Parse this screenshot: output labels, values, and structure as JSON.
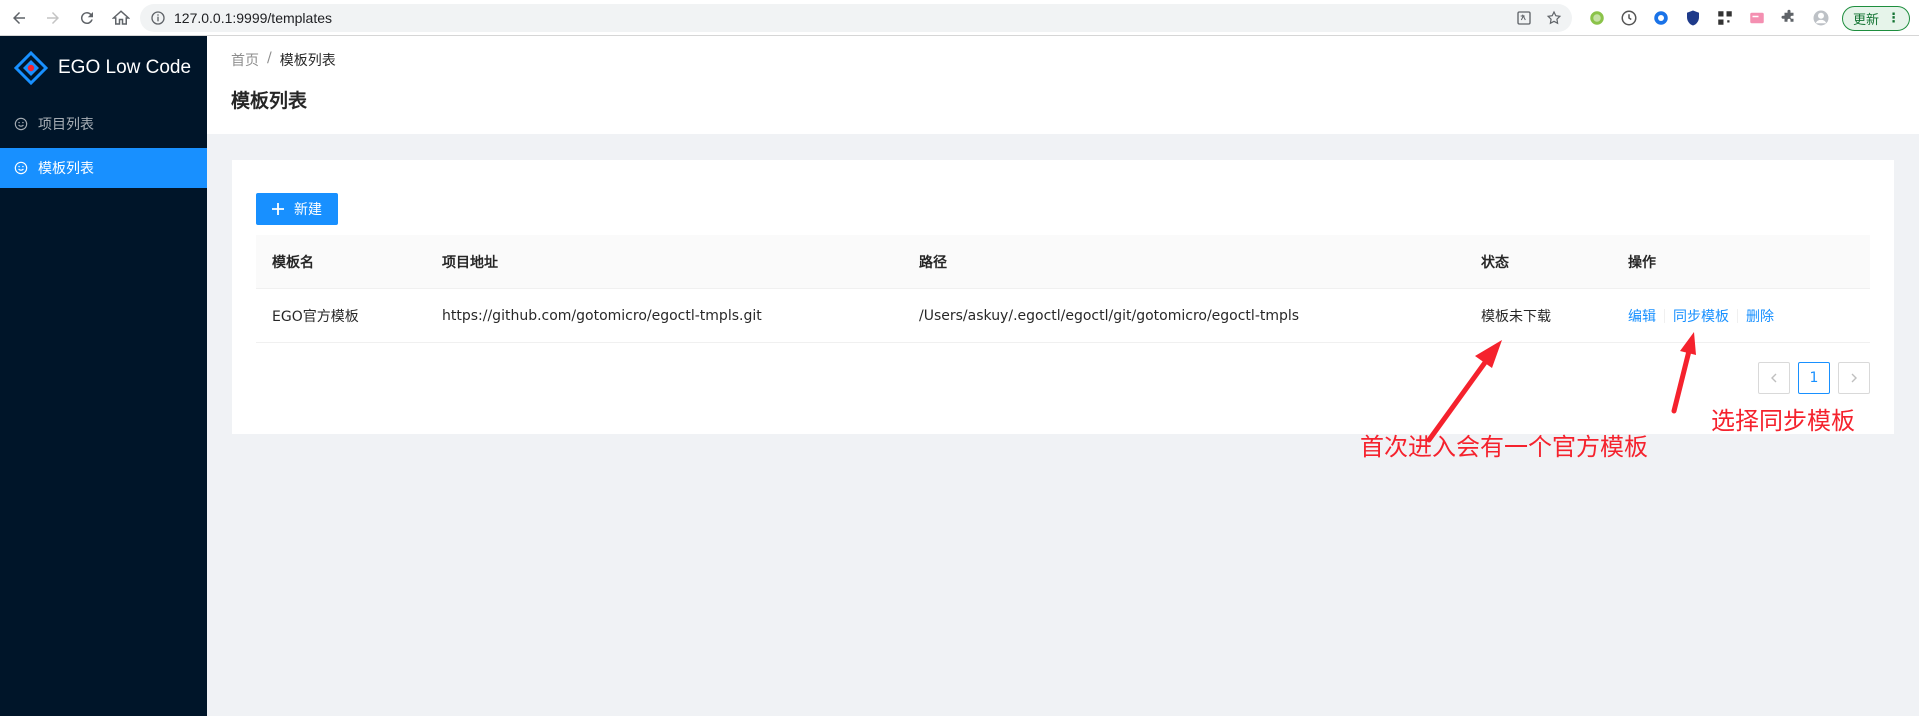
{
  "browser": {
    "url": "127.0.0.1:9999/templates",
    "update_label": "更新"
  },
  "sidebar": {
    "brand": "EGO Low Code",
    "items": [
      {
        "label": "项目列表",
        "active": false
      },
      {
        "label": "模板列表",
        "active": true
      }
    ]
  },
  "header": {
    "breadcrumb": [
      "首页",
      "/",
      "模板列表"
    ],
    "title": "模板列表"
  },
  "toolbar": {
    "new_label": "新建"
  },
  "table": {
    "columns": [
      "模板名",
      "项目地址",
      "路径",
      "状态",
      "操作"
    ],
    "rows": [
      {
        "name": "EGO官方模板",
        "repo": "https://github.com/gotomicro/egoctl-tmpls.git",
        "path": "/Users/askuy/.egoctl/egoctl/git/gotomicro/egoctl-tmpls",
        "status": "模板未下载",
        "actions": [
          "编辑",
          "同步模板",
          "删除"
        ]
      }
    ]
  },
  "pagination": {
    "current": "1"
  },
  "annotations": {
    "first": "首次进入会有一个官方模板",
    "second": "选择同步模板",
    "color": "#f5222d"
  },
  "colors": {
    "primary": "#1890ff",
    "sider": "#001529"
  }
}
